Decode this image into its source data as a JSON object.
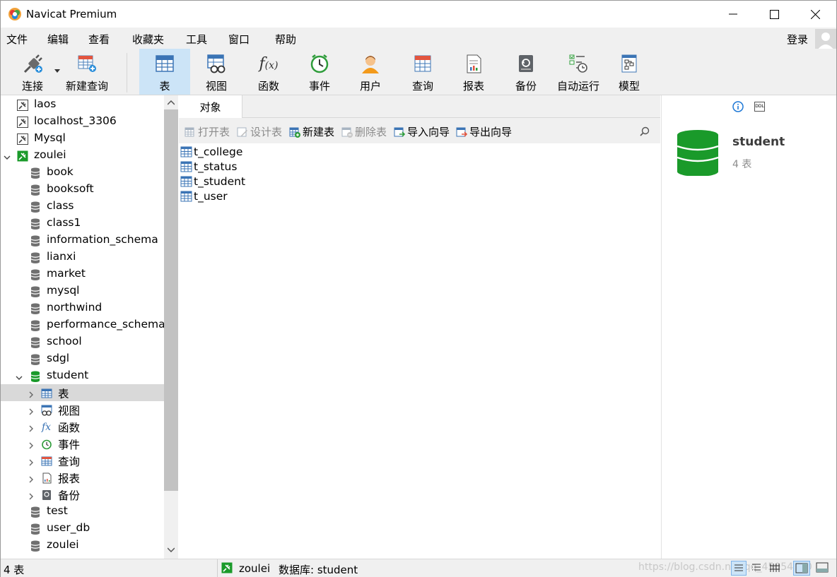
{
  "window": {
    "title": "Navicat Premium"
  },
  "menu": [
    "文件",
    "编辑",
    "查看",
    "收藏夹",
    "工具",
    "窗口",
    "帮助"
  ],
  "login_label": "登录",
  "toolbar": [
    {
      "label": "连接",
      "icon": "connect-icon"
    },
    {
      "label": "新建查询",
      "icon": "new-query-icon"
    },
    {
      "label": "表",
      "icon": "table-icon",
      "active": true
    },
    {
      "label": "视图",
      "icon": "view-icon"
    },
    {
      "label": "函数",
      "icon": "function-icon"
    },
    {
      "label": "事件",
      "icon": "event-icon"
    },
    {
      "label": "用户",
      "icon": "user-icon"
    },
    {
      "label": "查询",
      "icon": "query-icon"
    },
    {
      "label": "报表",
      "icon": "report-icon"
    },
    {
      "label": "备份",
      "icon": "backup-icon"
    },
    {
      "label": "自动运行",
      "icon": "automation-icon"
    },
    {
      "label": "模型",
      "icon": "model-icon"
    }
  ],
  "tree": [
    {
      "label": "laos",
      "kind": "conn-off",
      "depth": 0
    },
    {
      "label": "localhost_3306",
      "kind": "conn-off",
      "depth": 0
    },
    {
      "label": "Mysql",
      "kind": "conn-off",
      "depth": 0
    },
    {
      "label": "zoulei",
      "kind": "conn-on",
      "depth": 0,
      "expanded": true
    },
    {
      "label": "book",
      "kind": "db",
      "depth": 1
    },
    {
      "label": "booksoft",
      "kind": "db",
      "depth": 1
    },
    {
      "label": "class",
      "kind": "db",
      "depth": 1
    },
    {
      "label": "class1",
      "kind": "db",
      "depth": 1
    },
    {
      "label": "information_schema",
      "kind": "db",
      "depth": 1
    },
    {
      "label": "lianxi",
      "kind": "db",
      "depth": 1
    },
    {
      "label": "market",
      "kind": "db",
      "depth": 1
    },
    {
      "label": "mysql",
      "kind": "db",
      "depth": 1
    },
    {
      "label": "northwind",
      "kind": "db",
      "depth": 1
    },
    {
      "label": "performance_schema",
      "kind": "db",
      "depth": 1
    },
    {
      "label": "school",
      "kind": "db",
      "depth": 1
    },
    {
      "label": "sdgl",
      "kind": "db",
      "depth": 1
    },
    {
      "label": "student",
      "kind": "db-open",
      "depth": 1,
      "expanded": true
    },
    {
      "label": "表",
      "kind": "tables",
      "depth": 2,
      "selected": true
    },
    {
      "label": "视图",
      "kind": "views",
      "depth": 2
    },
    {
      "label": "函数",
      "kind": "functions",
      "depth": 2
    },
    {
      "label": "事件",
      "kind": "events",
      "depth": 2
    },
    {
      "label": "查询",
      "kind": "queries",
      "depth": 2
    },
    {
      "label": "报表",
      "kind": "reports",
      "depth": 2
    },
    {
      "label": "备份",
      "kind": "backups",
      "depth": 2
    },
    {
      "label": "test",
      "kind": "db",
      "depth": 1
    },
    {
      "label": "user_db",
      "kind": "db",
      "depth": 1
    },
    {
      "label": "zoulei",
      "kind": "db",
      "depth": 1
    }
  ],
  "center": {
    "tab": "对象",
    "actions": [
      {
        "label": "打开表",
        "enabled": false
      },
      {
        "label": "设计表",
        "enabled": false
      },
      {
        "label": "新建表",
        "enabled": true
      },
      {
        "label": "删除表",
        "enabled": false
      },
      {
        "label": "导入向导",
        "enabled": true
      },
      {
        "label": "导出向导",
        "enabled": true
      }
    ],
    "tables": [
      "t_college",
      "t_status",
      "t_student",
      "t_user"
    ]
  },
  "info": {
    "db_name": "student",
    "count": "4 表",
    "ddl_label": "DDL"
  },
  "status": {
    "left": "4 表",
    "connection": "zoulei",
    "database": "数据库: student",
    "watermark": "https://blog.csdn.net/qq_45054330"
  },
  "colors": {
    "accent": "#cce4f7",
    "db_green": "#1a9a2a",
    "link_blue": "#1e78d6"
  }
}
